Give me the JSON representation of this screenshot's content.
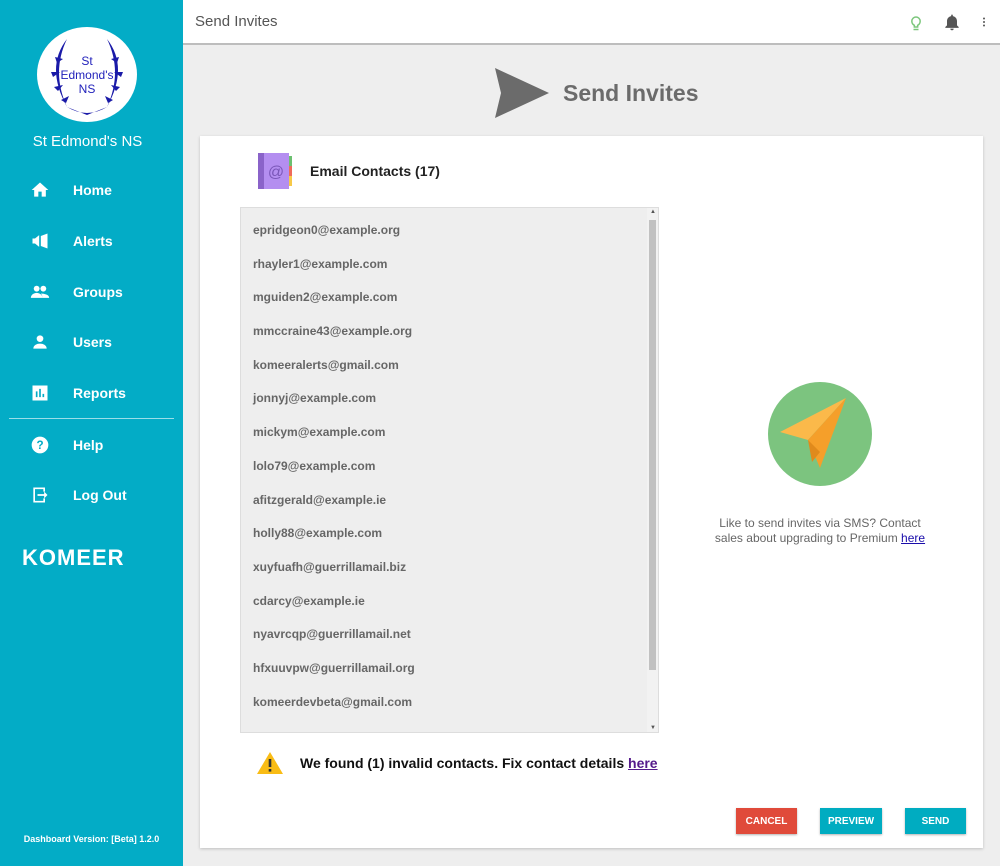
{
  "sidebar": {
    "school_name": "St Edmond's NS",
    "logo_text": "St Edmond's NS",
    "items": [
      {
        "label": "Home",
        "icon": "home-icon"
      },
      {
        "label": "Alerts",
        "icon": "megaphone-icon"
      },
      {
        "label": "Groups",
        "icon": "group-icon"
      },
      {
        "label": "Users",
        "icon": "user-icon"
      },
      {
        "label": "Reports",
        "icon": "chart-icon"
      }
    ],
    "bottom_items": [
      {
        "label": "Help",
        "icon": "help-icon"
      },
      {
        "label": "Log Out",
        "icon": "logout-icon"
      }
    ],
    "brand": "KOMEER",
    "version": "Dashboard Version: [Beta] 1.2.0"
  },
  "topbar": {
    "title": "Send Invites"
  },
  "page": {
    "heading": "Send Invites",
    "contacts_title": "Email Contacts (17)",
    "contacts": [
      "epridgeon0@example.org",
      "rhayler1@example.com",
      "mguiden2@example.com",
      "mmccraine43@example.org",
      "komeeralerts@gmail.com",
      "jonnyj@example.com",
      "mickym@example.com",
      "lolo79@example.com",
      "afitzgerald@example.ie",
      "holly88@example.com",
      "xuyfuafh@guerrillamail.biz",
      "cdarcy@example.ie",
      "nyavrcqp@guerrillamail.net",
      "hfxuuvpw@guerrillamail.org",
      "komeerdevbeta@gmail.com"
    ],
    "warning_text": "We found (1) invalid contacts. Fix contact details ",
    "warning_link": "here",
    "promo_text": "Like to send invites via SMS? Contact sales about upgrading to Premium ",
    "promo_link": "here",
    "buttons": {
      "cancel": "CANCEL",
      "preview": "PREVIEW",
      "send": "SEND"
    }
  },
  "colors": {
    "sidebar": "#03acc6",
    "cancel": "#e04a3a",
    "primary": "#00acc1"
  }
}
